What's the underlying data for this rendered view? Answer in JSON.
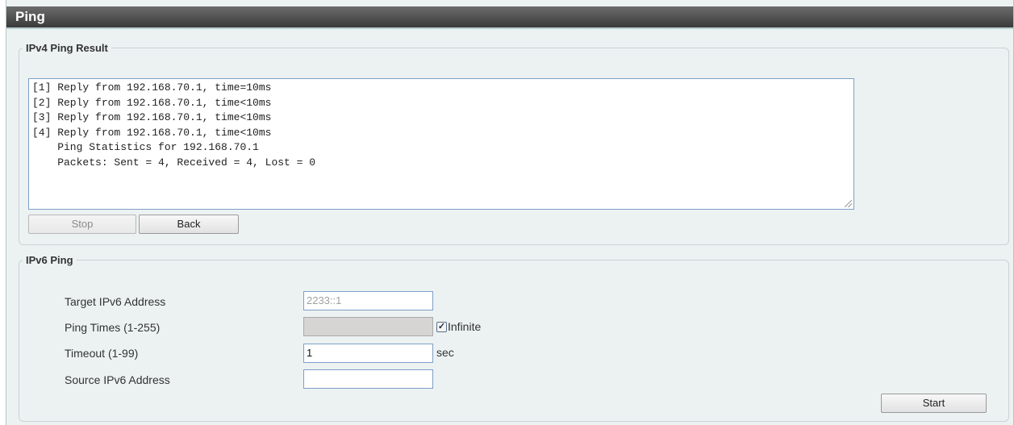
{
  "page": {
    "title": "Ping"
  },
  "ipv4": {
    "legend": "IPv4 Ping Result",
    "result_lines": [
      "[1] Reply from 192.168.70.1, time=10ms",
      "[2] Reply from 192.168.70.1, time<10ms",
      "[3] Reply from 192.168.70.1, time<10ms",
      "[4] Reply from 192.168.70.1, time<10ms",
      "    Ping Statistics for 192.168.70.1",
      "    Packets: Sent = 4, Received = 4, Lost = 0"
    ],
    "stop_label": "Stop",
    "back_label": "Back"
  },
  "ipv6": {
    "legend": "IPv6 Ping",
    "target_label": "Target IPv6 Address",
    "target_placeholder": "2233::1",
    "target_value": "",
    "ping_times_label": "Ping Times (1-255)",
    "ping_times_value": "",
    "infinite_label": "Infinite",
    "infinite_checked": true,
    "timeout_label": "Timeout (1-99)",
    "timeout_value": "1",
    "timeout_unit": "sec",
    "source_label": "Source IPv6 Address",
    "source_value": "",
    "start_label": "Start"
  }
}
